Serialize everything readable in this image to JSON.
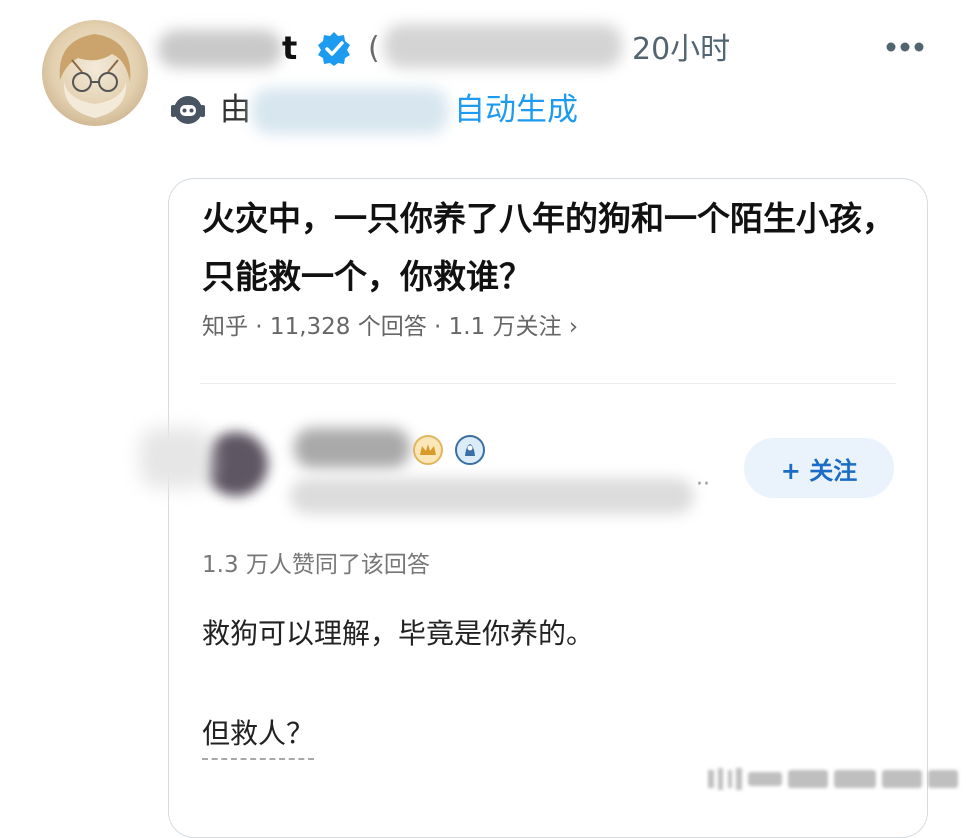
{
  "header": {
    "author_name_visible": "t",
    "handle_open_paren": "(",
    "time": "20小时",
    "generated_prefix": "由",
    "generated_suffix": "自动生成"
  },
  "icons": [
    "avatar",
    "verified-badge-icon",
    "more-icon",
    "bot-icon",
    "crown-badge-icon",
    "emblem-badge-icon"
  ],
  "card": {
    "question_title": "火灾中，一只你养了八年的狗和一个陌生小孩，只能救一个，你救谁？",
    "meta": "知乎 · 11,328 个回答 · 1.1 万关注 ›",
    "ellipsis": "··",
    "follow_label": "+ 关注",
    "upvotes": "1.3 万人赞同了该回答",
    "answer_line_1": "救狗可以理解，毕竟是你养的。",
    "answer_line_2": "但救人？"
  },
  "colors": {
    "accent_blue": "#1d9bf0",
    "follow_text": "#1a6cc4",
    "follow_bg": "#eaf3fb",
    "muted_gray": "#666666"
  }
}
